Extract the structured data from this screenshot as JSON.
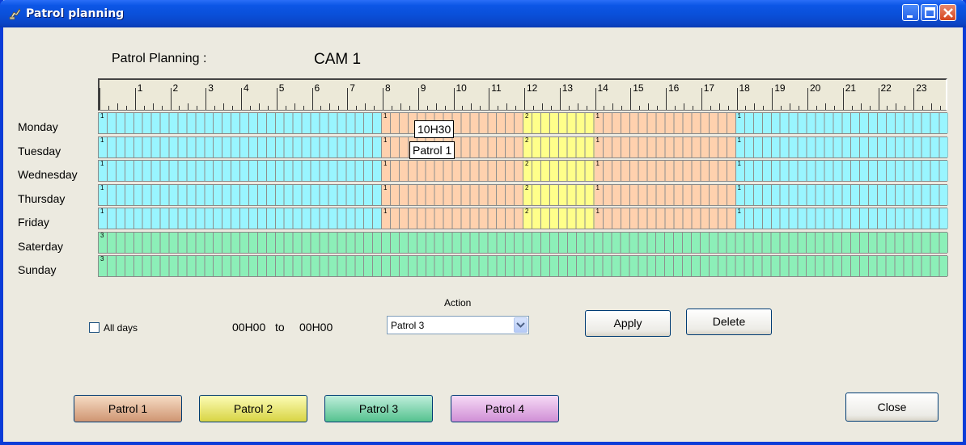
{
  "window": {
    "title": "Patrol planning"
  },
  "header": {
    "label": "Patrol Planning :",
    "camera": "CAM 1"
  },
  "ruler": {
    "hours": [
      "1",
      "2",
      "3",
      "4",
      "5",
      "6",
      "7",
      "8",
      "9",
      "10",
      "11",
      "12",
      "13",
      "14",
      "15",
      "16",
      "17",
      "18",
      "19",
      "20",
      "21",
      "22",
      "23"
    ]
  },
  "colors": {
    "idle": "#99f5ff",
    "patrol1": "#ffd1ae",
    "patrol2": "#ffff8a",
    "patrol3": "#8cefb8",
    "patrol4": "#f2a8f7"
  },
  "schedule": [
    {
      "day": "Monday",
      "segments": [
        {
          "from": 0,
          "to": 8,
          "mark": "1",
          "kind": "idle"
        },
        {
          "from": 8,
          "to": 12,
          "mark": "1",
          "kind": "patrol1"
        },
        {
          "from": 12,
          "to": 14,
          "mark": "2",
          "kind": "patrol2"
        },
        {
          "from": 14,
          "to": 18,
          "mark": "1",
          "kind": "patrol1"
        },
        {
          "from": 18,
          "to": 24,
          "mark": "1",
          "kind": "idle"
        }
      ]
    },
    {
      "day": "Tuesday",
      "segments": [
        {
          "from": 0,
          "to": 8,
          "mark": "1",
          "kind": "idle"
        },
        {
          "from": 8,
          "to": 12,
          "mark": "1",
          "kind": "patrol1"
        },
        {
          "from": 12,
          "to": 14,
          "mark": "2",
          "kind": "patrol2"
        },
        {
          "from": 14,
          "to": 18,
          "mark": "1",
          "kind": "patrol1"
        },
        {
          "from": 18,
          "to": 24,
          "mark": "1",
          "kind": "idle"
        }
      ]
    },
    {
      "day": "Wednesday",
      "segments": [
        {
          "from": 0,
          "to": 8,
          "mark": "1",
          "kind": "idle"
        },
        {
          "from": 8,
          "to": 12,
          "mark": "1",
          "kind": "patrol1"
        },
        {
          "from": 12,
          "to": 14,
          "mark": "2",
          "kind": "patrol2"
        },
        {
          "from": 14,
          "to": 18,
          "mark": "1",
          "kind": "patrol1"
        },
        {
          "from": 18,
          "to": 24,
          "mark": "1",
          "kind": "idle"
        }
      ]
    },
    {
      "day": "Thursday",
      "segments": [
        {
          "from": 0,
          "to": 8,
          "mark": "1",
          "kind": "idle"
        },
        {
          "from": 8,
          "to": 12,
          "mark": "1",
          "kind": "patrol1"
        },
        {
          "from": 12,
          "to": 14,
          "mark": "2",
          "kind": "patrol2"
        },
        {
          "from": 14,
          "to": 18,
          "mark": "1",
          "kind": "patrol1"
        },
        {
          "from": 18,
          "to": 24,
          "mark": "1",
          "kind": "idle"
        }
      ]
    },
    {
      "day": "Friday",
      "segments": [
        {
          "from": 0,
          "to": 8,
          "mark": "1",
          "kind": "idle"
        },
        {
          "from": 8,
          "to": 12,
          "mark": "1",
          "kind": "patrol1"
        },
        {
          "from": 12,
          "to": 14,
          "mark": "2",
          "kind": "patrol2"
        },
        {
          "from": 14,
          "to": 18,
          "mark": "1",
          "kind": "patrol1"
        },
        {
          "from": 18,
          "to": 24,
          "mark": "1",
          "kind": "idle"
        }
      ]
    },
    {
      "day": "Saterday",
      "segments": [
        {
          "from": 0,
          "to": 24,
          "mark": "3",
          "kind": "patrol3"
        }
      ]
    },
    {
      "day": "Sunday",
      "segments": [
        {
          "from": 0,
          "to": 24,
          "mark": "3",
          "kind": "patrol3"
        }
      ]
    }
  ],
  "tooltip": {
    "time": "10H30",
    "patrol": "Patrol 1"
  },
  "controls": {
    "all_days_label": "All days",
    "time_from": "00H00",
    "to_label": "to",
    "time_to": "00H00",
    "action_label": "Action",
    "action_value": "Patrol 3",
    "apply_label": "Apply",
    "delete_label": "Delete",
    "close_label": "Close"
  },
  "patrol_buttons": [
    "Patrol 1",
    "Patrol 2",
    "Patrol 3",
    "Patrol 4"
  ]
}
